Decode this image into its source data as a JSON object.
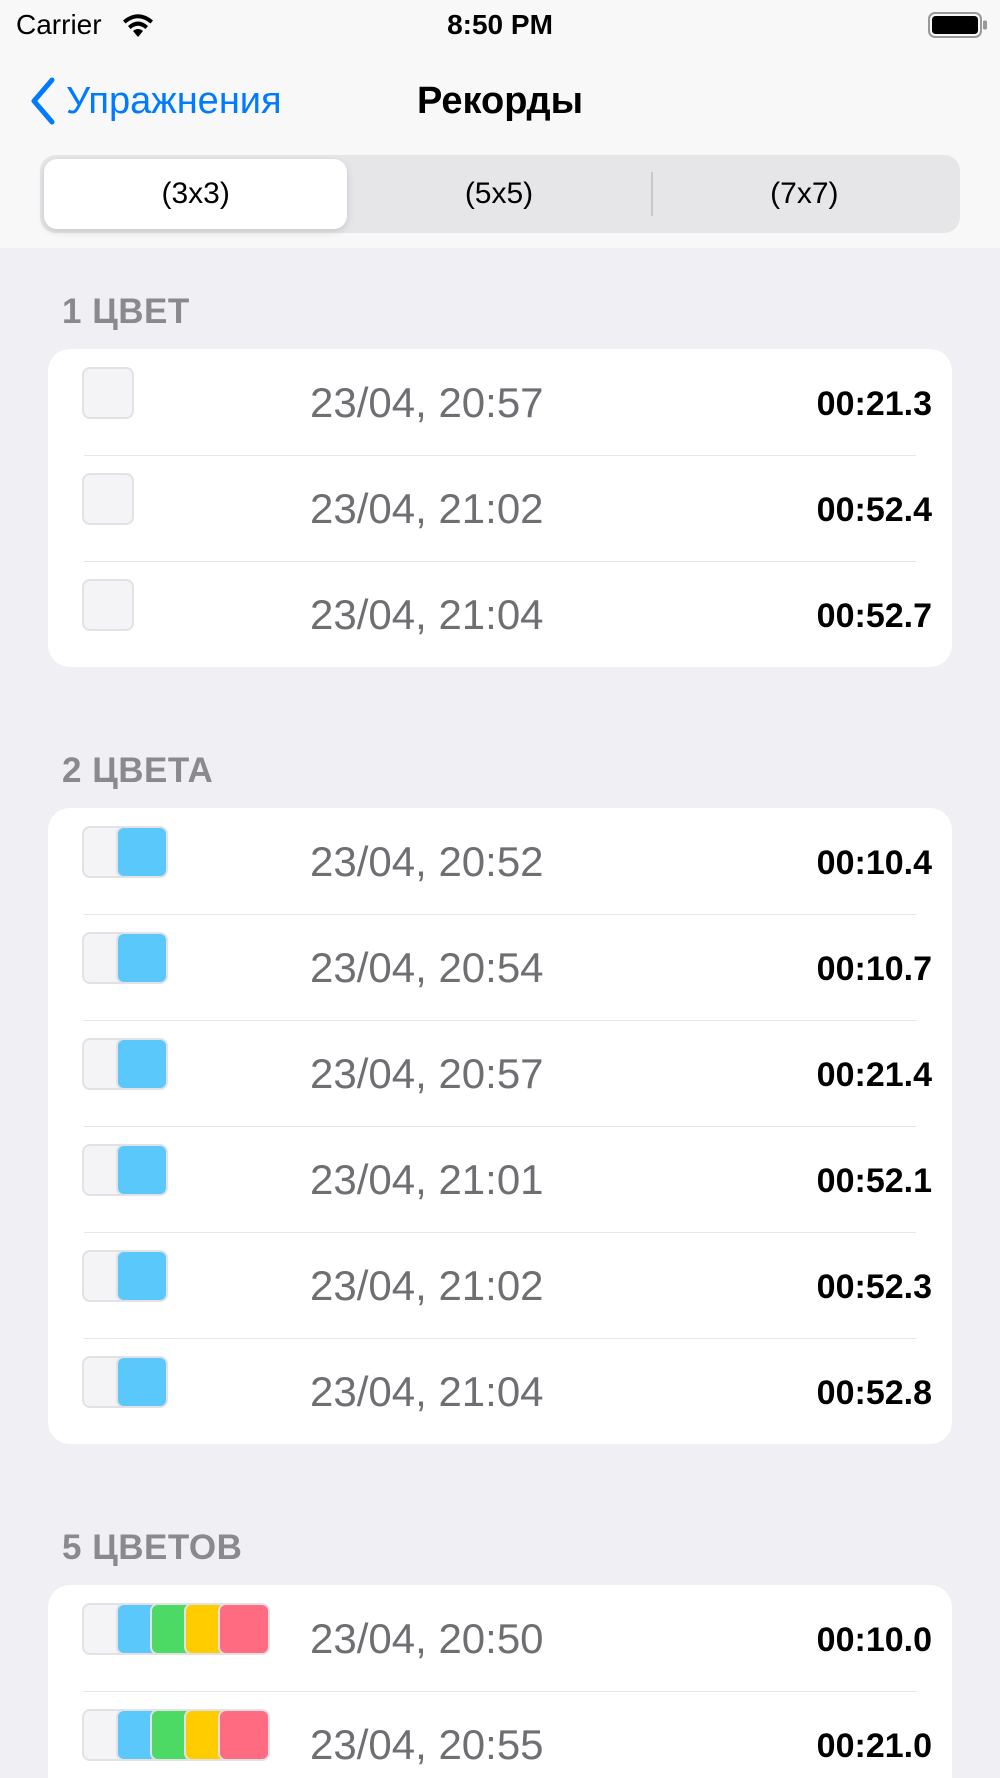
{
  "status_bar": {
    "carrier": "Carrier",
    "time": "8:50 PM",
    "wifi_icon": "wifi-icon",
    "battery_icon": "battery-icon"
  },
  "nav": {
    "back_label": "Упражнения",
    "back_icon": "chevron-left-icon",
    "title": "Рекорды"
  },
  "segments": [
    {
      "label": "(3x3)",
      "selected": true
    },
    {
      "label": "(5x5)",
      "selected": false
    },
    {
      "label": "(7x7)",
      "selected": false
    }
  ],
  "colors": {
    "accent": "#007aff",
    "empty_swatch": "#f4f4f6",
    "blue_swatch": "#5ac8fa",
    "green_swatch": "#4cd964",
    "yellow_swatch": "#ffcc00",
    "pink_swatch": "#ff6b81"
  },
  "sections": [
    {
      "header": "1 ЦВЕТ",
      "rows": [
        {
          "swatches": [
            "#f4f4f6"
          ],
          "date": "23/04, 20:57",
          "time": "00:21.3"
        },
        {
          "swatches": [
            "#f4f4f6"
          ],
          "date": "23/04, 21:02",
          "time": "00:52.4"
        },
        {
          "swatches": [
            "#f4f4f6"
          ],
          "date": "23/04, 21:04",
          "time": "00:52.7"
        }
      ]
    },
    {
      "header": "2 ЦВЕТА",
      "rows": [
        {
          "swatches": [
            "#f4f4f6",
            "#5ac8fa"
          ],
          "date": "23/04, 20:52",
          "time": "00:10.4"
        },
        {
          "swatches": [
            "#f4f4f6",
            "#5ac8fa"
          ],
          "date": "23/04, 20:54",
          "time": "00:10.7"
        },
        {
          "swatches": [
            "#f4f4f6",
            "#5ac8fa"
          ],
          "date": "23/04, 20:57",
          "time": "00:21.4"
        },
        {
          "swatches": [
            "#f4f4f6",
            "#5ac8fa"
          ],
          "date": "23/04, 21:01",
          "time": "00:52.1"
        },
        {
          "swatches": [
            "#f4f4f6",
            "#5ac8fa"
          ],
          "date": "23/04, 21:02",
          "time": "00:52.3"
        },
        {
          "swatches": [
            "#f4f4f6",
            "#5ac8fa"
          ],
          "date": "23/04, 21:04",
          "time": "00:52.8"
        }
      ]
    },
    {
      "header": "5 ЦВЕТОВ",
      "rows": [
        {
          "swatches": [
            "#f4f4f6",
            "#5ac8fa",
            "#4cd964",
            "#ffcc00",
            "#ff6b81"
          ],
          "date": "23/04, 20:50",
          "time": "00:10.0"
        },
        {
          "swatches": [
            "#f4f4f6",
            "#5ac8fa",
            "#4cd964",
            "#ffcc00",
            "#ff6b81"
          ],
          "date": "23/04, 20:55",
          "time": "00:21.0"
        }
      ]
    }
  ]
}
